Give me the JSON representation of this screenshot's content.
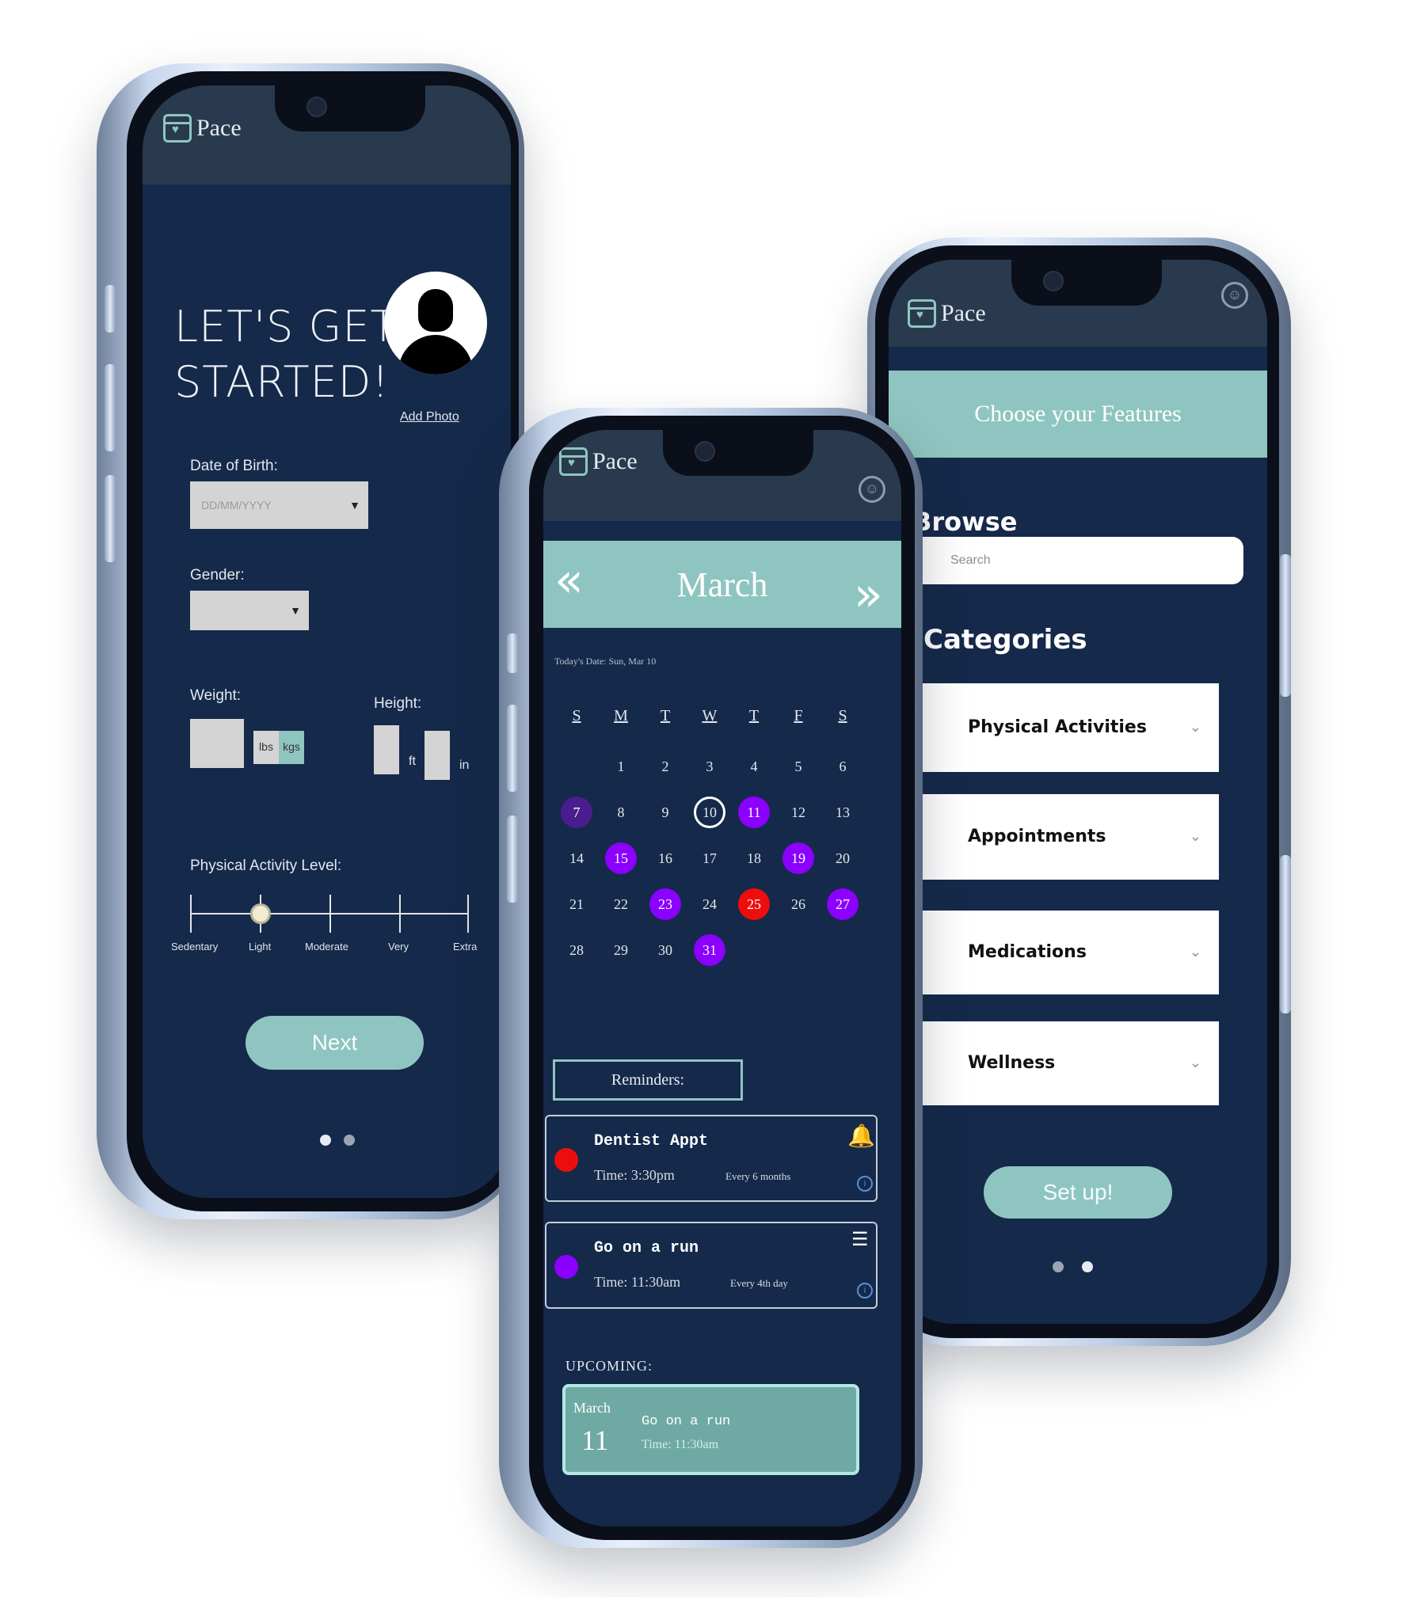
{
  "brand": {
    "name": "Pace"
  },
  "phone1": {
    "title_line1": "LET'S GET",
    "title_line2": "STARTED!",
    "add_photo": "Add Photo",
    "dob_label": "Date of Birth:",
    "dob_placeholder": "DD/MM/YYYY",
    "gender_label": "Gender:",
    "weight_label": "Weight:",
    "weight_units": [
      "lbs",
      "kgs"
    ],
    "height_label": "Height:",
    "height_units": [
      "ft",
      "in"
    ],
    "activity_label": "Physical Activity Level:",
    "activity_levels": [
      "Sedentary",
      "Light",
      "Moderate",
      "Very",
      "Extra"
    ],
    "activity_selected": "Light",
    "next_button": "Next",
    "page_dots": {
      "count": 2,
      "active": 0
    }
  },
  "phone2": {
    "month": "March",
    "today_text": "Today's Date: Sun, Mar 10",
    "weekdays": [
      "S",
      "M",
      "T",
      "W",
      "T",
      "F",
      "S"
    ],
    "weeks": [
      [
        "",
        "1",
        "2",
        "3",
        "4",
        "5",
        "6"
      ],
      [
        "7",
        "8",
        "9",
        "10",
        "11",
        "12",
        "13"
      ],
      [
        "14",
        "15",
        "16",
        "17",
        "18",
        "19",
        "20"
      ],
      [
        "21",
        "22",
        "23",
        "24",
        "25",
        "26",
        "27"
      ],
      [
        "28",
        "29",
        "30",
        "31",
        "",
        "",
        ""
      ]
    ],
    "highlight_colors": {
      "purple": "#8b00ff",
      "red": "#ee0d0d",
      "dark_purple": "#4a1d8e"
    },
    "reminders_label": "Reminders:",
    "reminders": [
      {
        "title": "Dentist Appt",
        "time": "Time: 3:30pm",
        "frequency": "Every 6 months",
        "color": "#ee0d0d",
        "icon": "bell-icon"
      },
      {
        "title": "Go on a run",
        "time": "Time: 11:30am",
        "frequency": "Every 4th day",
        "color": "#8b00ff",
        "icon": "notes-icon"
      }
    ],
    "upcoming_label": "UPCOMING:",
    "upcoming": {
      "month": "March",
      "day": "11",
      "title": "Go on a run",
      "time": "Time: 11:30am"
    }
  },
  "phone3": {
    "header": "Choose your Features",
    "browse": "Browse",
    "search_placeholder": "Search",
    "categories_title": "Categories",
    "categories": [
      "Physical Activities",
      "Appointments",
      "Medications",
      "Wellness"
    ],
    "setup_button": "Set up!",
    "page_dots": {
      "count": 2,
      "active": 1
    }
  }
}
